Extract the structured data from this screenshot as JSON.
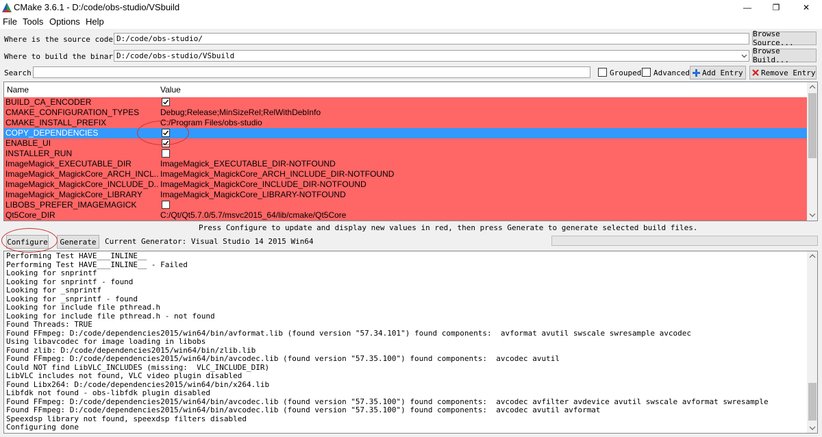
{
  "window": {
    "title": "CMake 3.6.1 - D:/code/obs-studio/VSbuild",
    "minimize_glyph": "—",
    "maximize_glyph": "❐",
    "close_glyph": "✕"
  },
  "menu": [
    "File",
    "Tools",
    "Options",
    "Help"
  ],
  "source": {
    "label": "Where is the source code:",
    "value": "D:/code/obs-studio/",
    "button": "Browse Source..."
  },
  "build": {
    "label": "Where to build the binaries:",
    "value": "D:/code/obs-studio/VSbuild",
    "button": "Browse Build..."
  },
  "search": {
    "label": "Search:",
    "value": "",
    "grouped_label": "Grouped",
    "grouped_checked": false,
    "advanced_label": "Advanced",
    "advanced_checked": false,
    "add_entry": "Add Entry",
    "remove_entry": "Remove Entry"
  },
  "table": {
    "columns": [
      "Name",
      "Value"
    ],
    "rows": [
      {
        "name": "BUILD_CA_ENCODER",
        "type": "bool",
        "checked": true
      },
      {
        "name": "CMAKE_CONFIGURATION_TYPES",
        "type": "text",
        "value": "Debug;Release;MinSizeRel;RelWithDebInfo"
      },
      {
        "name": "CMAKE_INSTALL_PREFIX",
        "type": "text",
        "value": "C:/Program Files/obs-studio"
      },
      {
        "name": "COPY_DEPENDENCIES",
        "type": "bool",
        "checked": true,
        "selected": true
      },
      {
        "name": "ENABLE_UI",
        "type": "bool",
        "checked": true
      },
      {
        "name": "INSTALLER_RUN",
        "type": "bool",
        "checked": false
      },
      {
        "name": "ImageMagick_EXECUTABLE_DIR",
        "type": "text",
        "value": "ImageMagick_EXECUTABLE_DIR-NOTFOUND"
      },
      {
        "name": "ImageMagick_MagickCore_ARCH_INCL...",
        "type": "text",
        "value": "ImageMagick_MagickCore_ARCH_INCLUDE_DIR-NOTFOUND"
      },
      {
        "name": "ImageMagick_MagickCore_INCLUDE_D...",
        "type": "text",
        "value": "ImageMagick_MagickCore_INCLUDE_DIR-NOTFOUND"
      },
      {
        "name": "ImageMagick_MagickCore_LIBRARY",
        "type": "text",
        "value": "ImageMagick_MagickCore_LIBRARY-NOTFOUND"
      },
      {
        "name": "LIBOBS_PREFER_IMAGEMAGICK",
        "type": "bool",
        "checked": false
      },
      {
        "name": "Qt5Core_DIR",
        "type": "text",
        "value": "C:/Qt/Qt5.7.0/5.7/msvc2015_64/lib/cmake/Qt5Core"
      }
    ]
  },
  "hint": "Press Configure to update and display new values in red, then press Generate to generate selected build files.",
  "actions": {
    "configure": "Configure",
    "generate": "Generate",
    "generator": "Current Generator: Visual Studio 14 2015 Win64"
  },
  "output": [
    "Performing Test HAVE___INLINE__",
    "Performing Test HAVE___INLINE__ - Failed",
    "Looking for snprintf",
    "Looking for snprintf - found",
    "Looking for _snprintf",
    "Looking for _snprintf - found",
    "Looking for include file pthread.h",
    "Looking for include file pthread.h - not found",
    "Found Threads: TRUE",
    "Found FFmpeg: D:/code/dependencies2015/win64/bin/avformat.lib (found version \"57.34.101\") found components:  avformat avutil swscale swresample avcodec",
    "Using libavcodec for image loading in libobs",
    "Found zlib: D:/code/dependencies2015/win64/bin/zlib.lib",
    "Found FFmpeg: D:/code/dependencies2015/win64/bin/avcodec.lib (found version \"57.35.100\") found components:  avcodec avutil",
    "Could NOT find LibVLC_INCLUDES (missing:  VLC_INCLUDE_DIR)",
    "LibVLC includes not found, VLC video plugin disabled",
    "Found Libx264: D:/code/dependencies2015/win64/bin/x264.lib",
    "Libfdk not found - obs-libfdk plugin disabled",
    "Found FFmpeg: D:/code/dependencies2015/win64/bin/avcodec.lib (found version \"57.35.100\") found components:  avcodec avfilter avdevice avutil swscale avformat swresample",
    "Found FFmpeg: D:/code/dependencies2015/win64/bin/avcodec.lib (found version \"57.35.100\") found components:  avcodec avutil avformat",
    "Speexdsp library not found, speexdsp filters disabled",
    "Configuring done"
  ],
  "icons": {
    "app": "cmake-triangle-icon",
    "add": "plus-icon",
    "remove": "x-icon",
    "dropdown": "chevron-down-icon"
  },
  "colors": {
    "new_entry_bg": "#ff6666",
    "selection_bg": "#3399ff",
    "annotation": "#d03030"
  }
}
